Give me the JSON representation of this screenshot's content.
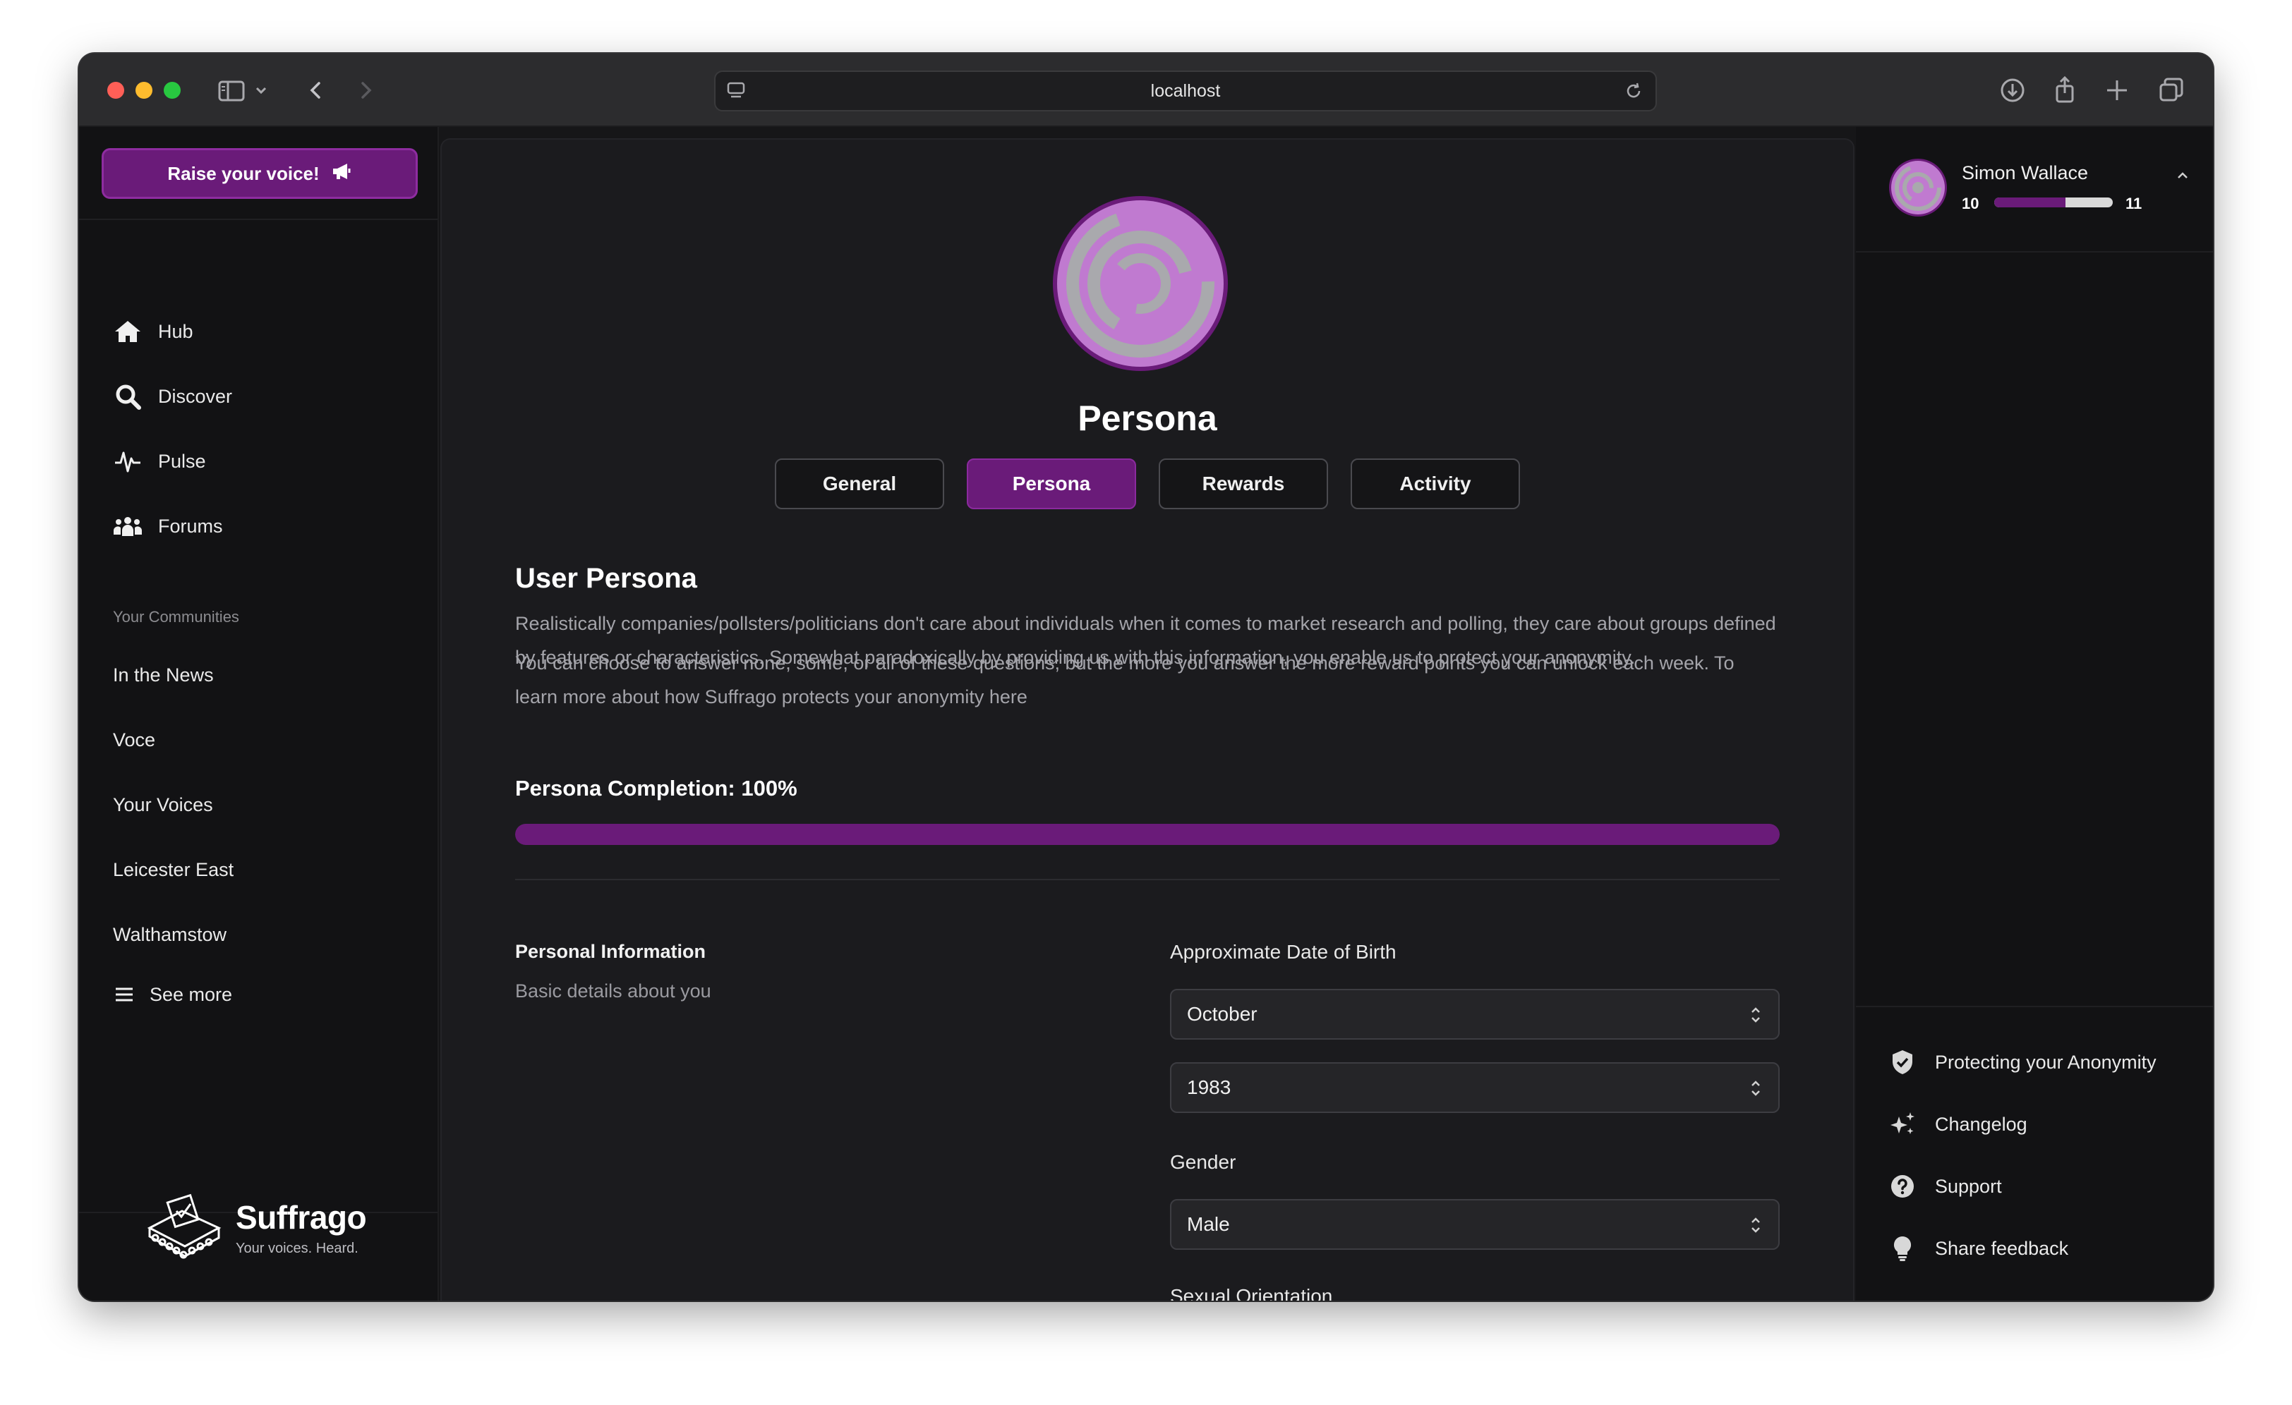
{
  "browser": {
    "url": "localhost"
  },
  "sidebar": {
    "raise_button": "Raise your voice!",
    "nav": [
      {
        "label": "Hub",
        "icon": "home-icon"
      },
      {
        "label": "Discover",
        "icon": "search-icon"
      },
      {
        "label": "Pulse",
        "icon": "pulse-icon"
      },
      {
        "label": "Forums",
        "icon": "users-icon"
      }
    ],
    "communities_label": "Your Communities",
    "communities": [
      "In the News",
      "Voce",
      "Your Voices",
      "Leicester East",
      "Walthamstow"
    ],
    "see_more": "See more",
    "brand_name": "Suffrago",
    "brand_tagline": "Your voices. Heard."
  },
  "main": {
    "title": "Persona",
    "tabs": [
      {
        "label": "General",
        "active": false
      },
      {
        "label": "Persona",
        "active": true
      },
      {
        "label": "Rewards",
        "active": false
      },
      {
        "label": "Activity",
        "active": false
      }
    ],
    "heading": "User Persona",
    "para1": "Realistically companies/pollsters/politicians don't care about individuals when it comes to market research and polling, they care about groups defined by features or characteristics. Somewhat paradoxically by providing us with this information, you enable us to protect your anonymity.",
    "para2": "You can choose to answer none, some, or all of these questions; but the more you answer the more reward points you can unlock each week. To learn more about how Suffrago protects your anonymity here",
    "completion_label": "Persona Completion: 100%",
    "completion_value": 1.0,
    "section_title": "Personal Information",
    "section_subtitle": "Basic details about you",
    "dob_label": "Approximate Date of Birth",
    "dob_month": "October",
    "dob_year": "1983",
    "gender_label": "Gender",
    "gender_value": "Male",
    "next_label": "Sexual Orientation"
  },
  "user": {
    "name": "Simon Wallace",
    "level_current": "10",
    "level_next": "11",
    "xp_progress": 0.6
  },
  "rightpanel": {
    "links": [
      {
        "label": "Protecting your Anonymity",
        "icon": "shield-icon"
      },
      {
        "label": "Changelog",
        "icon": "sparkles-icon"
      },
      {
        "label": "Support",
        "icon": "question-icon"
      },
      {
        "label": "Share feedback",
        "icon": "lightbulb-icon"
      }
    ]
  },
  "colors": {
    "accent": "#6a1b79",
    "background": "#161618",
    "panel": "#1b1b1e"
  }
}
